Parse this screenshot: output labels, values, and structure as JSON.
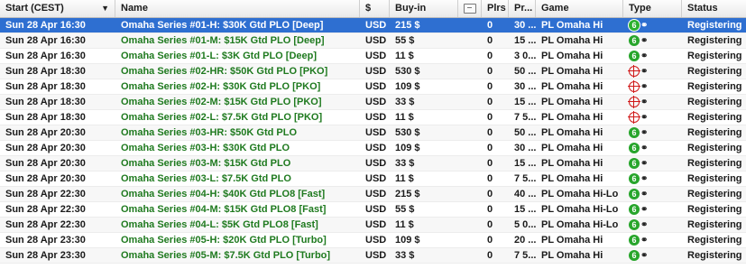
{
  "columns": {
    "start": "Start (CEST)",
    "sort_indicator": "▼",
    "name": "Name",
    "currency": "$",
    "buyin": "Buy-in",
    "plrs": "Plrs",
    "prize": "Pr...",
    "game": "Game",
    "type": "Type",
    "status": "Status"
  },
  "rows": [
    {
      "start": "Sun 28 Apr 16:30",
      "name": "Omaha Series #01-H: $30K Gtd PLO [Deep]",
      "currency": "USD",
      "buyin": "215 $",
      "plrs": "0",
      "prize": "30 ...",
      "game": "PL Omaha Hi",
      "type": "6",
      "status": "Registering",
      "selected": true
    },
    {
      "start": "Sun 28 Apr 16:30",
      "name": "Omaha Series #01-M: $15K Gtd PLO [Deep]",
      "currency": "USD",
      "buyin": "55 $",
      "plrs": "0",
      "prize": "15 ...",
      "game": "PL Omaha Hi",
      "type": "6",
      "status": "Registering"
    },
    {
      "start": "Sun 28 Apr 16:30",
      "name": "Omaha Series #01-L: $3K Gtd PLO [Deep]",
      "currency": "USD",
      "buyin": "11 $",
      "plrs": "0",
      "prize": "3 0...",
      "game": "PL Omaha Hi",
      "type": "6",
      "status": "Registering"
    },
    {
      "start": "Sun 28 Apr 18:30",
      "name": "Omaha Series #02-HR: $50K Gtd PLO [PKO]",
      "currency": "USD",
      "buyin": "530 $",
      "plrs": "0",
      "prize": "50 ...",
      "game": "PL Omaha Hi",
      "type": "pko",
      "status": "Registering"
    },
    {
      "start": "Sun 28 Apr 18:30",
      "name": "Omaha Series #02-H: $30K Gtd PLO [PKO]",
      "currency": "USD",
      "buyin": "109 $",
      "plrs": "0",
      "prize": "30 ...",
      "game": "PL Omaha Hi",
      "type": "pko",
      "status": "Registering"
    },
    {
      "start": "Sun 28 Apr 18:30",
      "name": "Omaha Series #02-M: $15K Gtd PLO [PKO]",
      "currency": "USD",
      "buyin": "33 $",
      "plrs": "0",
      "prize": "15 ...",
      "game": "PL Omaha Hi",
      "type": "pko",
      "status": "Registering"
    },
    {
      "start": "Sun 28 Apr 18:30",
      "name": "Omaha Series #02-L: $7.5K Gtd PLO [PKO]",
      "currency": "USD",
      "buyin": "11 $",
      "plrs": "0",
      "prize": "7 5...",
      "game": "PL Omaha Hi",
      "type": "pko",
      "status": "Registering"
    },
    {
      "start": "Sun 28 Apr 20:30",
      "name": "Omaha Series #03-HR: $50K Gtd PLO",
      "currency": "USD",
      "buyin": "530 $",
      "plrs": "0",
      "prize": "50 ...",
      "game": "PL Omaha Hi",
      "type": "6",
      "status": "Registering"
    },
    {
      "start": "Sun 28 Apr 20:30",
      "name": "Omaha Series #03-H: $30K Gtd PLO",
      "currency": "USD",
      "buyin": "109 $",
      "plrs": "0",
      "prize": "30 ...",
      "game": "PL Omaha Hi",
      "type": "6",
      "status": "Registering"
    },
    {
      "start": "Sun 28 Apr 20:30",
      "name": "Omaha Series #03-M: $15K Gtd PLO",
      "currency": "USD",
      "buyin": "33 $",
      "plrs": "0",
      "prize": "15 ...",
      "game": "PL Omaha Hi",
      "type": "6",
      "status": "Registering"
    },
    {
      "start": "Sun 28 Apr 20:30",
      "name": "Omaha Series #03-L: $7.5K Gtd PLO",
      "currency": "USD",
      "buyin": "11 $",
      "plrs": "0",
      "prize": "7 5...",
      "game": "PL Omaha Hi",
      "type": "6",
      "status": "Registering"
    },
    {
      "start": "Sun 28 Apr 22:30",
      "name": "Omaha Series #04-H: $40K Gtd PLO8 [Fast]",
      "currency": "USD",
      "buyin": "215 $",
      "plrs": "0",
      "prize": "40 ...",
      "game": "PL Omaha Hi-Lo",
      "type": "6",
      "status": "Registering"
    },
    {
      "start": "Sun 28 Apr 22:30",
      "name": "Omaha Series #04-M: $15K Gtd PLO8 [Fast]",
      "currency": "USD",
      "buyin": "55 $",
      "plrs": "0",
      "prize": "15 ...",
      "game": "PL Omaha Hi-Lo",
      "type": "6",
      "status": "Registering"
    },
    {
      "start": "Sun 28 Apr 22:30",
      "name": "Omaha Series #04-L: $5K Gtd PLO8 [Fast]",
      "currency": "USD",
      "buyin": "11 $",
      "plrs": "0",
      "prize": "5 0...",
      "game": "PL Omaha Hi-Lo",
      "type": "6",
      "status": "Registering"
    },
    {
      "start": "Sun 28 Apr 23:30",
      "name": "Omaha Series #05-H: $20K Gtd PLO [Turbo]",
      "currency": "USD",
      "buyin": "109 $",
      "plrs": "0",
      "prize": "20 ...",
      "game": "PL Omaha Hi",
      "type": "6",
      "status": "Registering"
    },
    {
      "start": "Sun 28 Apr 23:30",
      "name": "Omaha Series #05-M: $7.5K Gtd PLO [Turbo]",
      "currency": "USD",
      "buyin": "33 $",
      "plrs": "0",
      "prize": "7 5...",
      "game": "PL Omaha Hi",
      "type": "6",
      "status": "Registering"
    }
  ],
  "icons": {
    "type_badge": "six-max-badge-icon",
    "type_target": "bounty-target-icon",
    "type_small": "extra-type-icon",
    "ticket": "ticket-icon"
  },
  "colors": {
    "selected_bg": "#2e6fd1",
    "name_text": "#1f7a1f",
    "badge_green": "#27a52b",
    "target_red": "#d01818"
  }
}
